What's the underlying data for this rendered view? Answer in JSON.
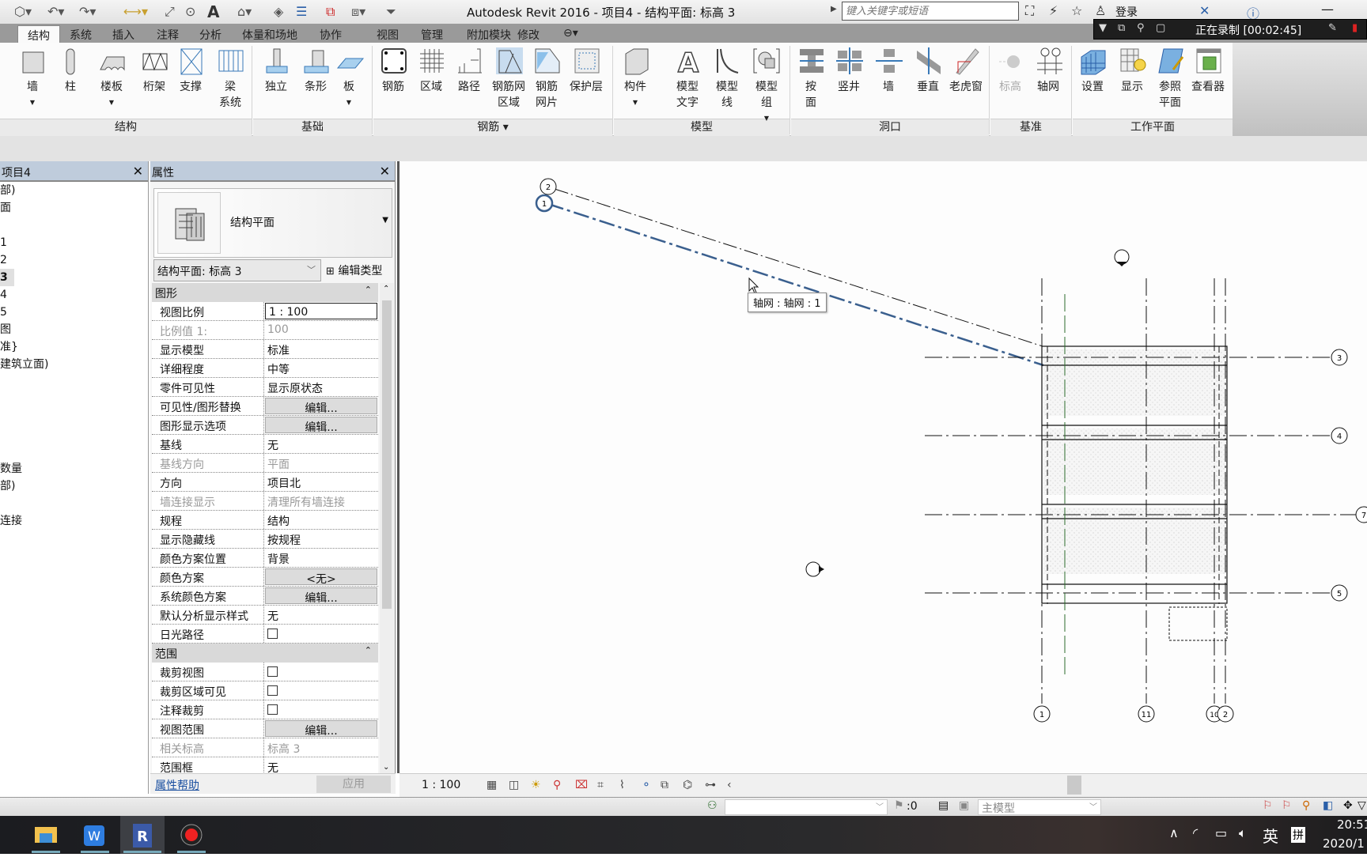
{
  "window": {
    "title": "Autodesk Revit 2016 -    项目4 - 结构平面: 标高 3",
    "minimize": "—"
  },
  "quick_access": {
    "icons": [
      "open-icon",
      "undo-icon",
      "redo-icon",
      "measure-icon",
      "dimension-icon",
      "tag-icon",
      "text-icon",
      "3d-view-icon",
      "section-icon",
      "thin-lines-icon",
      "close-hidden-icon",
      "switch-windows-icon",
      "customize-icon"
    ],
    "text_glyph": "A"
  },
  "search": {
    "placeholder": "键入关键字或短语"
  },
  "header": {
    "login": "登录"
  },
  "recording": {
    "label": "正在录制 [00:02:45]"
  },
  "tabs": [
    "结构",
    "系统",
    "插入",
    "注释",
    "分析",
    "体量和场地",
    "协作",
    "视图",
    "管理",
    "附加模块",
    "修改"
  ],
  "active_tab": "结构",
  "ribbon": {
    "panels": [
      {
        "label": "结构",
        "buttons": [
          {
            "l1": "墙",
            "dd": true
          },
          {
            "l1": "柱"
          },
          {
            "l1": "楼板",
            "dd": true
          },
          {
            "l1": "桁架"
          },
          {
            "l1": "支撑"
          },
          {
            "l1": "梁",
            "l2": "系统"
          }
        ]
      },
      {
        "label": "基础",
        "buttons": [
          {
            "l1": "独立"
          },
          {
            "l1": "条形"
          },
          {
            "l1": "板",
            "dd": true
          }
        ]
      },
      {
        "label": "钢筋 ▾",
        "buttons": [
          {
            "l1": "钢筋"
          },
          {
            "l1": "区域"
          },
          {
            "l1": "路径"
          },
          {
            "l1": "钢筋网",
            "l2": "区域"
          },
          {
            "l1": "钢筋",
            "l2": "网片"
          },
          {
            "l1": "保护层"
          }
        ]
      },
      {
        "label": "模型",
        "buttons": [
          {
            "l1": "构件",
            "dd": true
          },
          {
            "l1": "模型",
            "l2": "文字"
          },
          {
            "l1": "模型",
            "l2": "线"
          },
          {
            "l1": "模型",
            "l2": "组",
            "dd": true
          }
        ]
      },
      {
        "label": "洞口",
        "buttons": [
          {
            "l1": "按",
            "l2": "面"
          },
          {
            "l1": "竖井"
          },
          {
            "l1": "墙"
          },
          {
            "l1": "垂直"
          },
          {
            "l1": "老虎窗"
          }
        ]
      },
      {
        "label": "基准",
        "buttons": [
          {
            "l1": "标高",
            "disabled": true
          },
          {
            "l1": "轴网"
          }
        ]
      },
      {
        "label": "工作平面",
        "buttons": [
          {
            "l1": "设置"
          },
          {
            "l1": "显示"
          },
          {
            "l1": "参照",
            "l2": "平面"
          },
          {
            "l1": "查看器"
          }
        ]
      }
    ]
  },
  "project_browser": {
    "title": "项目4",
    "items": [
      "部)",
      "面",
      "",
      "1",
      "2",
      "3",
      "4",
      "5",
      "图",
      "准}",
      "建筑立面)",
      "",
      "",
      "",
      "",
      "",
      "数量",
      "部)",
      "",
      "连接"
    ],
    "selected_index": 5
  },
  "properties": {
    "title": "属性",
    "type_name": "结构平面",
    "instance_selector": "结构平面: 标高 3",
    "edit_type": "编辑类型",
    "sections": [
      {
        "name": "图形",
        "rows": [
          {
            "k": "视图比例",
            "v": "1 : 100",
            "style": "sel"
          },
          {
            "k": "比例值 1:",
            "v": "100",
            "ro": true
          },
          {
            "k": "显示模型",
            "v": "标准"
          },
          {
            "k": "详细程度",
            "v": "中等"
          },
          {
            "k": "零件可见性",
            "v": "显示原状态"
          },
          {
            "k": "可见性/图形替换",
            "v": "编辑...",
            "style": "btn"
          },
          {
            "k": "图形显示选项",
            "v": "编辑...",
            "style": "btn"
          },
          {
            "k": "基线",
            "v": "无"
          },
          {
            "k": "基线方向",
            "v": "平面",
            "ro": true
          },
          {
            "k": "方向",
            "v": "项目北"
          },
          {
            "k": "墙连接显示",
            "v": "清理所有墙连接",
            "ro": true
          },
          {
            "k": "规程",
            "v": "结构"
          },
          {
            "k": "显示隐藏线",
            "v": "按规程"
          },
          {
            "k": "颜色方案位置",
            "v": "背景"
          },
          {
            "k": "颜色方案",
            "v": "<无>",
            "style": "btn"
          },
          {
            "k": "系统颜色方案",
            "v": "编辑...",
            "style": "btn"
          },
          {
            "k": "默认分析显示样式",
            "v": "无"
          },
          {
            "k": "日光路径",
            "v": "",
            "checkbox": true,
            "checked": false
          }
        ]
      },
      {
        "name": "范围",
        "rows": [
          {
            "k": "裁剪视图",
            "v": "",
            "checkbox": true,
            "checked": false
          },
          {
            "k": "裁剪区域可见",
            "v": "",
            "checkbox": true,
            "checked": false
          },
          {
            "k": "注释裁剪",
            "v": "",
            "checkbox": true,
            "checked": false
          },
          {
            "k": "视图范围",
            "v": "编辑...",
            "style": "btn"
          },
          {
            "k": "相关标高",
            "v": "标高 3",
            "ro": true
          },
          {
            "k": "范围框",
            "v": "无"
          }
        ]
      }
    ],
    "help_link": "属性帮助",
    "apply": "应用"
  },
  "canvas": {
    "tooltip": "轴网 : 轴网 : 1",
    "grid_bubbles_vertical": [
      "1",
      "11",
      "10",
      "2"
    ],
    "grid_bubbles_horizontal": [
      "3",
      "4",
      "7",
      "5"
    ],
    "grid_bubbles_diagonal": [
      "2",
      "1"
    ]
  },
  "view_control_bar": {
    "scale": "1 : 100"
  },
  "status_bar": {
    "selection_count": ":0",
    "model": "主模型"
  },
  "taskbar": {
    "apps": [
      "file-explorer",
      "wps",
      "revit",
      "recorder"
    ],
    "ime_lang": "英",
    "ime_mode": "拼",
    "time": "20:51",
    "date": "2020/1"
  }
}
